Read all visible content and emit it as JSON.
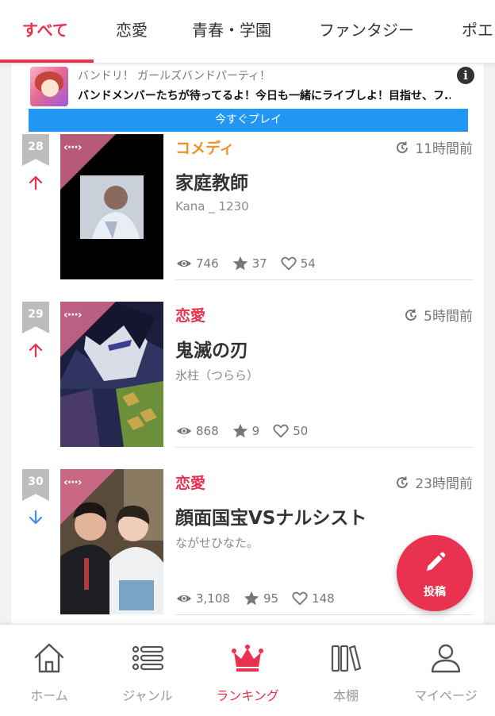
{
  "tabs": {
    "items": [
      "すべて",
      "恋愛",
      "青春・学園",
      "ファンタジー",
      "ポエ"
    ],
    "active_index": 0
  },
  "ad": {
    "title": "バンドリ！ ガールズバンドパーティ！",
    "description": "バンドメンバーたちが待ってるよ！今日も一緒にライブしよ！目指せ、フ...",
    "cta": "今すぐプレイ",
    "info_icon": "info-icon"
  },
  "entries": [
    {
      "rank": "28",
      "trend": "up",
      "genre": "コメディ",
      "genre_color": "#f0922b",
      "time": "11時間前",
      "title": "家庭教師",
      "author": "Kana _ 1230",
      "views": "746",
      "stars": "37",
      "likes": "54"
    },
    {
      "rank": "29",
      "trend": "up",
      "genre": "恋愛",
      "genre_color": "#e8324f",
      "time": "5時間前",
      "title": "鬼滅の刃",
      "author": "氷柱（つらら）",
      "views": "868",
      "stars": "9",
      "likes": "50"
    },
    {
      "rank": "30",
      "trend": "down",
      "genre": "恋愛",
      "genre_color": "#e8324f",
      "time": "23時間前",
      "title": "顔面国宝VSナルシスト",
      "author": "ながせひなた。",
      "views": "3,108",
      "stars": "95",
      "likes": "148"
    }
  ],
  "thumbnail_mark": "‹···›",
  "fab": {
    "label": "投稿",
    "icon": "pencil-icon"
  },
  "bottom_nav": {
    "items": [
      {
        "label": "ホーム",
        "icon": "home-icon"
      },
      {
        "label": "ジャンル",
        "icon": "list-icon"
      },
      {
        "label": "ランキング",
        "icon": "crown-icon"
      },
      {
        "label": "本棚",
        "icon": "bookshelf-icon"
      },
      {
        "label": "マイページ",
        "icon": "person-icon"
      }
    ],
    "active_index": 2
  },
  "colors": {
    "accent": "#e8324f",
    "comedy": "#f0922b",
    "trend_up": "#e8324f",
    "trend_down": "#3f8ee8",
    "ad_button": "#2196f3",
    "rank_badge": "#bdbdbd"
  }
}
